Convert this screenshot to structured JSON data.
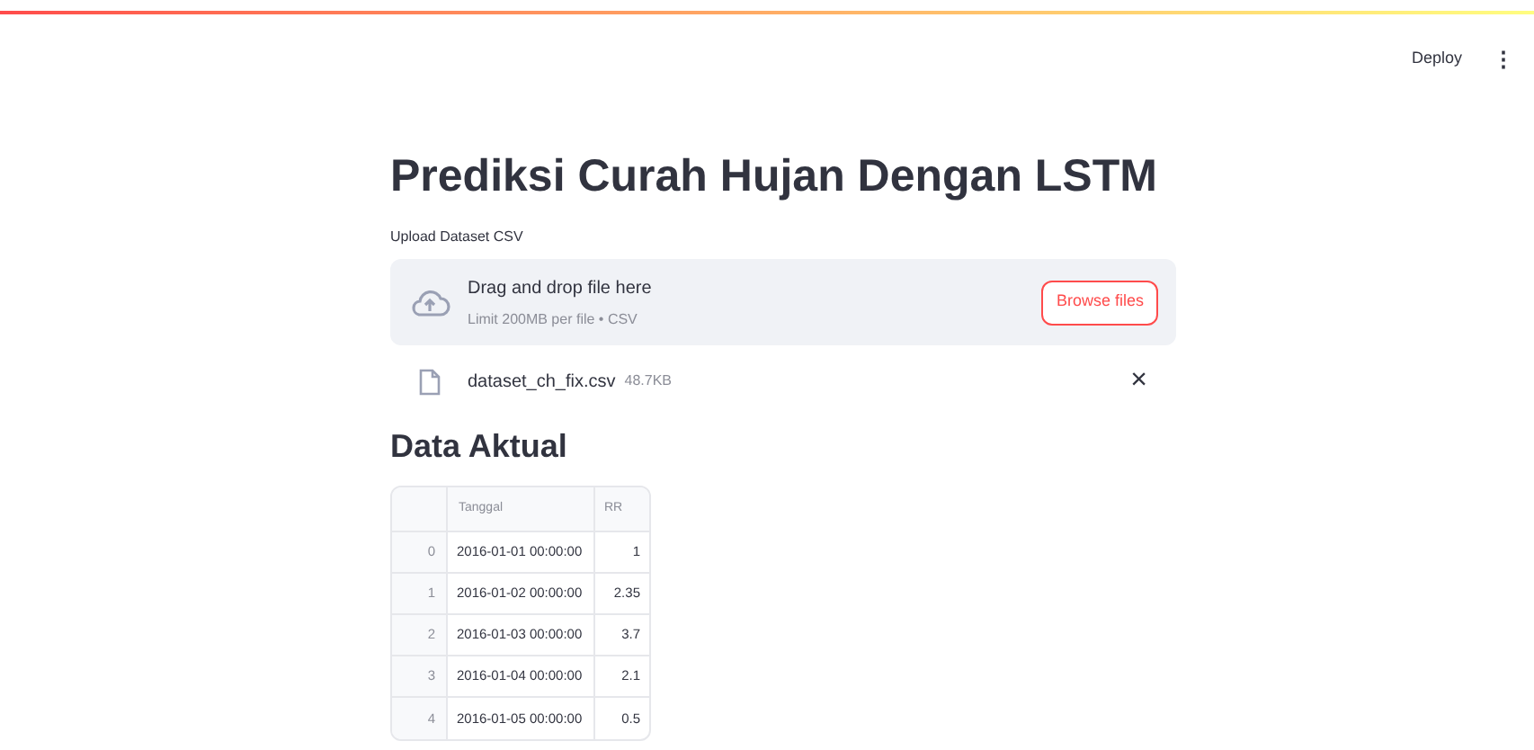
{
  "header": {
    "deploy": "Deploy",
    "menu": "⋮"
  },
  "title": "Prediksi Curah Hujan Dengan LSTM",
  "uploader": {
    "label": "Upload Dataset CSV",
    "prompt": "Drag and drop file here",
    "limit": "Limit 200MB per file • CSV",
    "button": "Browse files"
  },
  "file": {
    "name": "dataset_ch_fix.csv",
    "size": "48.7KB",
    "remove": "×"
  },
  "section": "Data Aktual",
  "table": {
    "columns": [
      "Tanggal",
      "RR"
    ],
    "rows": [
      {
        "index": "0",
        "cells": [
          "2016-01-01 00:00:00",
          "1"
        ]
      },
      {
        "index": "1",
        "cells": [
          "2016-01-02 00:00:00",
          "2.35"
        ]
      },
      {
        "index": "2",
        "cells": [
          "2016-01-03 00:00:00",
          "3.7"
        ]
      },
      {
        "index": "3",
        "cells": [
          "2016-01-04 00:00:00",
          "2.1"
        ]
      },
      {
        "index": "4",
        "cells": [
          "2016-01-05 00:00:00",
          "0.5"
        ]
      }
    ]
  }
}
